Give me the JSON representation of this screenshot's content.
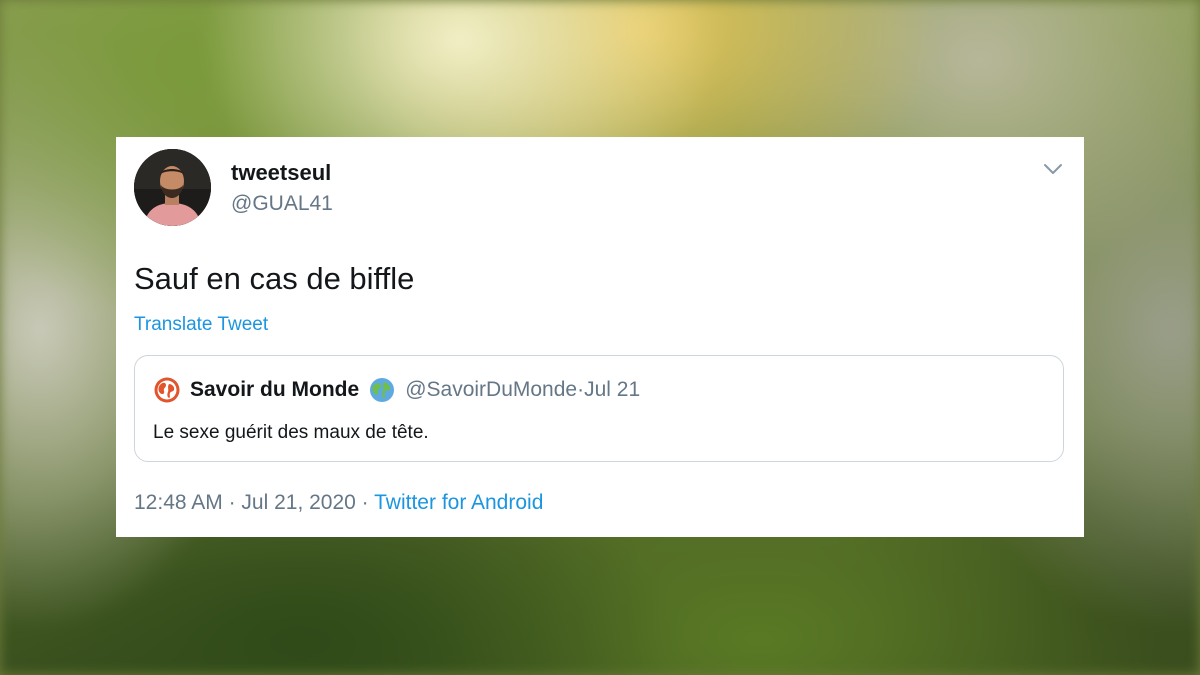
{
  "tweet": {
    "author_name": "tweetseul",
    "author_handle": "@GUAL41",
    "text": "Sauf en cas de biffle",
    "translate_label": "Translate Tweet",
    "time": "12:48 AM",
    "separator": " · ",
    "date": "Jul 21, 2020",
    "source": "Twitter for Android"
  },
  "quoted": {
    "author_name": "Savoir du Monde",
    "author_handle": "@SavoirDuMonde",
    "meta_separator": " · ",
    "date": "Jul 21",
    "text": "Le sexe guérit des maux de tête."
  },
  "icons": {
    "menu": "chevron-down-icon",
    "quoted_avatar": "earth-logo-icon",
    "name_emoji": "globe-icon"
  },
  "colors": {
    "link": "#1b95e0",
    "text": "#14171a",
    "muted": "#657786",
    "border": "#ccd6dd",
    "quoted_logo": "#e2542b"
  }
}
